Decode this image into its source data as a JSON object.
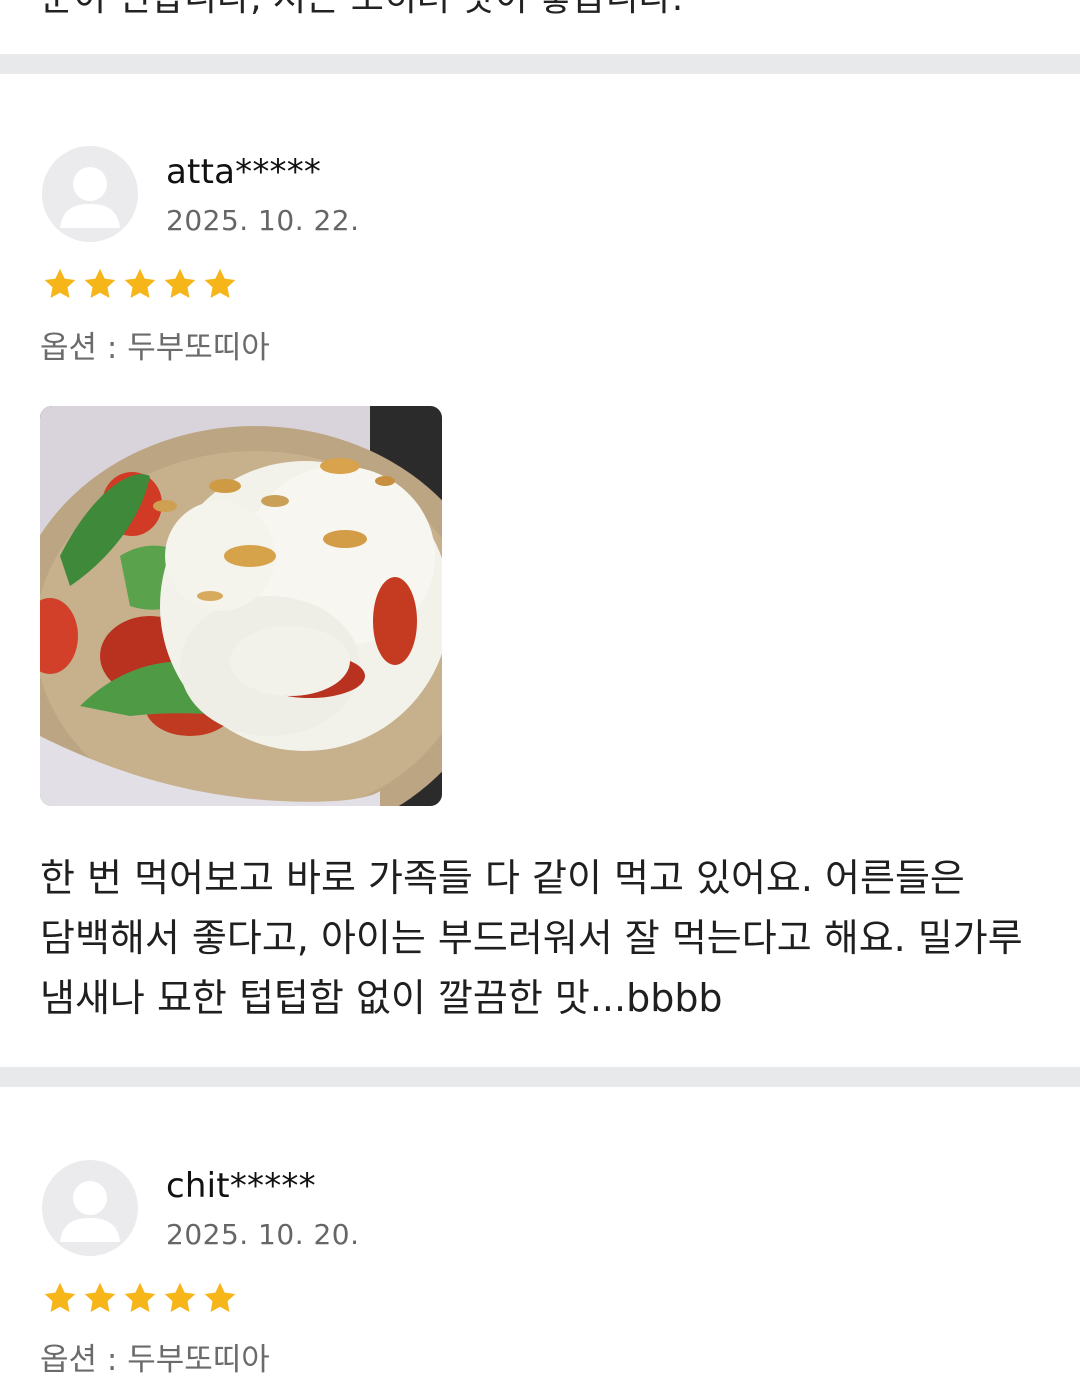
{
  "previous_review": {
    "text_tail": "분이 편합니다, 저는 오히려 맛이 좋습니다."
  },
  "reviews": [
    {
      "username": "atta*****",
      "date": "2025. 10. 22.",
      "rating": 5,
      "option": "옵션 : 두부또띠아",
      "has_photo": true,
      "text": "한 번 먹어보고 바로 가족들 다 같이 먹고 있어요. 어른들은 담백해서 좋다고, 아이는 부드러워서 잘 먹는다고 해요. 밀가루 냄새나 묘한 텁텁함 없이 깔끔한 맛...bbbb"
    },
    {
      "username": "chit*****",
      "date": "2025. 10. 20.",
      "rating": 5,
      "option": "옵션 : 두부또띠아"
    }
  ],
  "colors": {
    "star": "#f6b519",
    "divider": "#e8e9eb",
    "avatar_bg": "#ebebed",
    "avatar_fg": "#ffffff"
  },
  "icons": {
    "avatar": "user-silhouette-icon",
    "star": "star-filled-icon"
  }
}
